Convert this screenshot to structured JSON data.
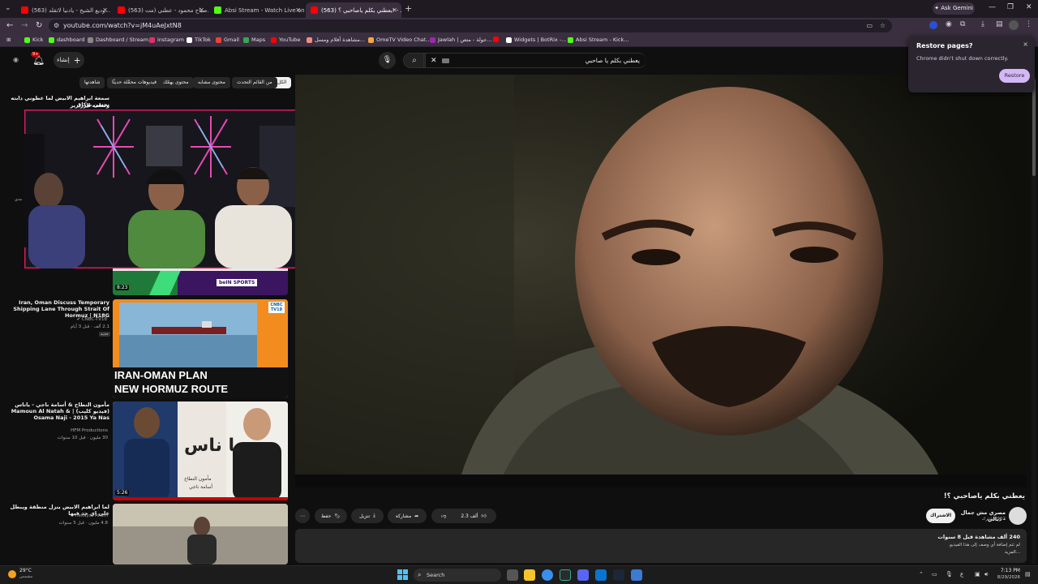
{
  "browser": {
    "tabs": [
      {
        "label": "(563) وديع الشيخ - يادنيا لاتقلد...",
        "active": false,
        "color": "#ff0000"
      },
      {
        "label": "(563) صباح محمود - عطني (مت...",
        "active": false,
        "color": "#ff0000"
      },
      {
        "label": "Absi Stream - Watch Live on Ki...",
        "active": false,
        "color": "#53fc18"
      },
      {
        "label": "(563) يعطني بكلم ياصاحبي ؟! - ...",
        "active": true,
        "color": "#ff0000"
      }
    ],
    "new_tab": "+",
    "ask_gemini": "Ask Gemini",
    "url": "youtube.com/watch?v=jM4uAeJxtN8",
    "bookmarks": [
      {
        "label": "Kick",
        "color": "#53fc18"
      },
      {
        "label": "dashboard",
        "color": "#53fc18"
      },
      {
        "label": "Dashboard / Stream...",
        "color": "#888888"
      },
      {
        "label": "instagram",
        "color": "#e1306c"
      },
      {
        "label": "TikTok",
        "color": "#ffffff"
      },
      {
        "label": "Gmail",
        "color": "#ea4335"
      },
      {
        "label": "Maps",
        "color": "#34a853"
      },
      {
        "label": "YouTube",
        "color": "#ff0000"
      },
      {
        "label": "مشاهدة أفلام ومسل...",
        "color": "#f28b82"
      },
      {
        "label": "OmeTV Video Chat...",
        "color": "#f4a742"
      },
      {
        "label": "Jawlah | جولة - متص...",
        "color": "#9c27b0"
      },
      {
        "label": "",
        "color": "#ff0000"
      },
      {
        "label": "Widgets | BotRix -...",
        "color": "#ffffff"
      },
      {
        "label": "Absi Stream - Kick...",
        "color": "#53fc18"
      }
    ]
  },
  "restore_popup": {
    "title": "Restore pages?",
    "message": "Chrome didn't shut down correctly.",
    "button": "Restore",
    "close": "×"
  },
  "youtube": {
    "search_value": "يعطني بكلم يا صاحبي",
    "notifications": "9+",
    "create_label": "إنشاء",
    "chips": [
      {
        "label": "الكل",
        "active": true
      },
      {
        "label": "من القائم التحدث",
        "active": false
      },
      {
        "label": "محتوى مشابه",
        "active": false
      },
      {
        "label": "محتوى يهمّك",
        "active": false
      },
      {
        "label": "فيديوهات محمَّلة حديثًا",
        "active": false
      },
      {
        "label": "شاهدتها",
        "active": false
      }
    ],
    "sidebar": [
      {
        "title": "سمعة ابراهيم الابيض لما عطوني دابته نحسن بوكاي",
        "title2": "وسلمه الرزازير",
        "channel": "",
        "meta": "",
        "duration": ""
      },
      {
        "title": "",
        "channel": "",
        "meta": "",
        "duration": "8:23",
        "badge": "beIN SPORTS"
      },
      {
        "title": "Iran, Oman Discuss Temporary Shipping Lane Through Strait Of Hormuz | N18G",
        "channel": "CNBC-TV18",
        "meta": "2.1 ألف · قبل 3 أيام",
        "tag": "جديد",
        "duration": "",
        "thumb_line1": "IRAN-OMAN PLAN",
        "thumb_line2": "NEW HORMUZ ROUTE",
        "thumb_logo": "CNBC TV18"
      },
      {
        "title": "مأمون النطاح & أسامة ناجي - ياناس (فيديو كليب) | Mamoun Al Natah & Osama Naji - 2015 Ya Nas",
        "channel": "HFM Productions",
        "meta": "30 مليون · قبل 10 سنوات",
        "duration": "5:26",
        "thumb_title": "يا ناس",
        "thumb_sub1": "مأمون النطاح",
        "thumb_sub2": "أسامة ناجي"
      },
      {
        "title": "لما ابراهيم الابيض ينزل منطقة ويبطل على اي حد فيها",
        "channel": "Hekayat Aflam",
        "meta": "4.8 مليون · قبل 5 سنوات",
        "duration": ""
      }
    ],
    "video": {
      "title": "يعطني بكلم ياصاحبي ؟!",
      "channel": "مصري مش جمال - ديالي",
      "subscribers": "962 مشترك",
      "subscribe_label": "الاشتراك",
      "likes": "2.3 ألف",
      "share_label": "مشاركة",
      "download_label": "تنزيل",
      "save_label": "حفظ",
      "more": "⋯",
      "views": "240 ألف مشاهدة قبل 8 سنوات",
      "description": "لم تتم إضافة أي وصف إلى هذا الفيديو.",
      "more_label": "...المزيد"
    }
  },
  "taskbar": {
    "weather_temp": "29°C",
    "weather_desc": "مشمس",
    "search": "Search",
    "time": "7:13 PM",
    "date": "8/29/2026",
    "lang": "ع"
  }
}
